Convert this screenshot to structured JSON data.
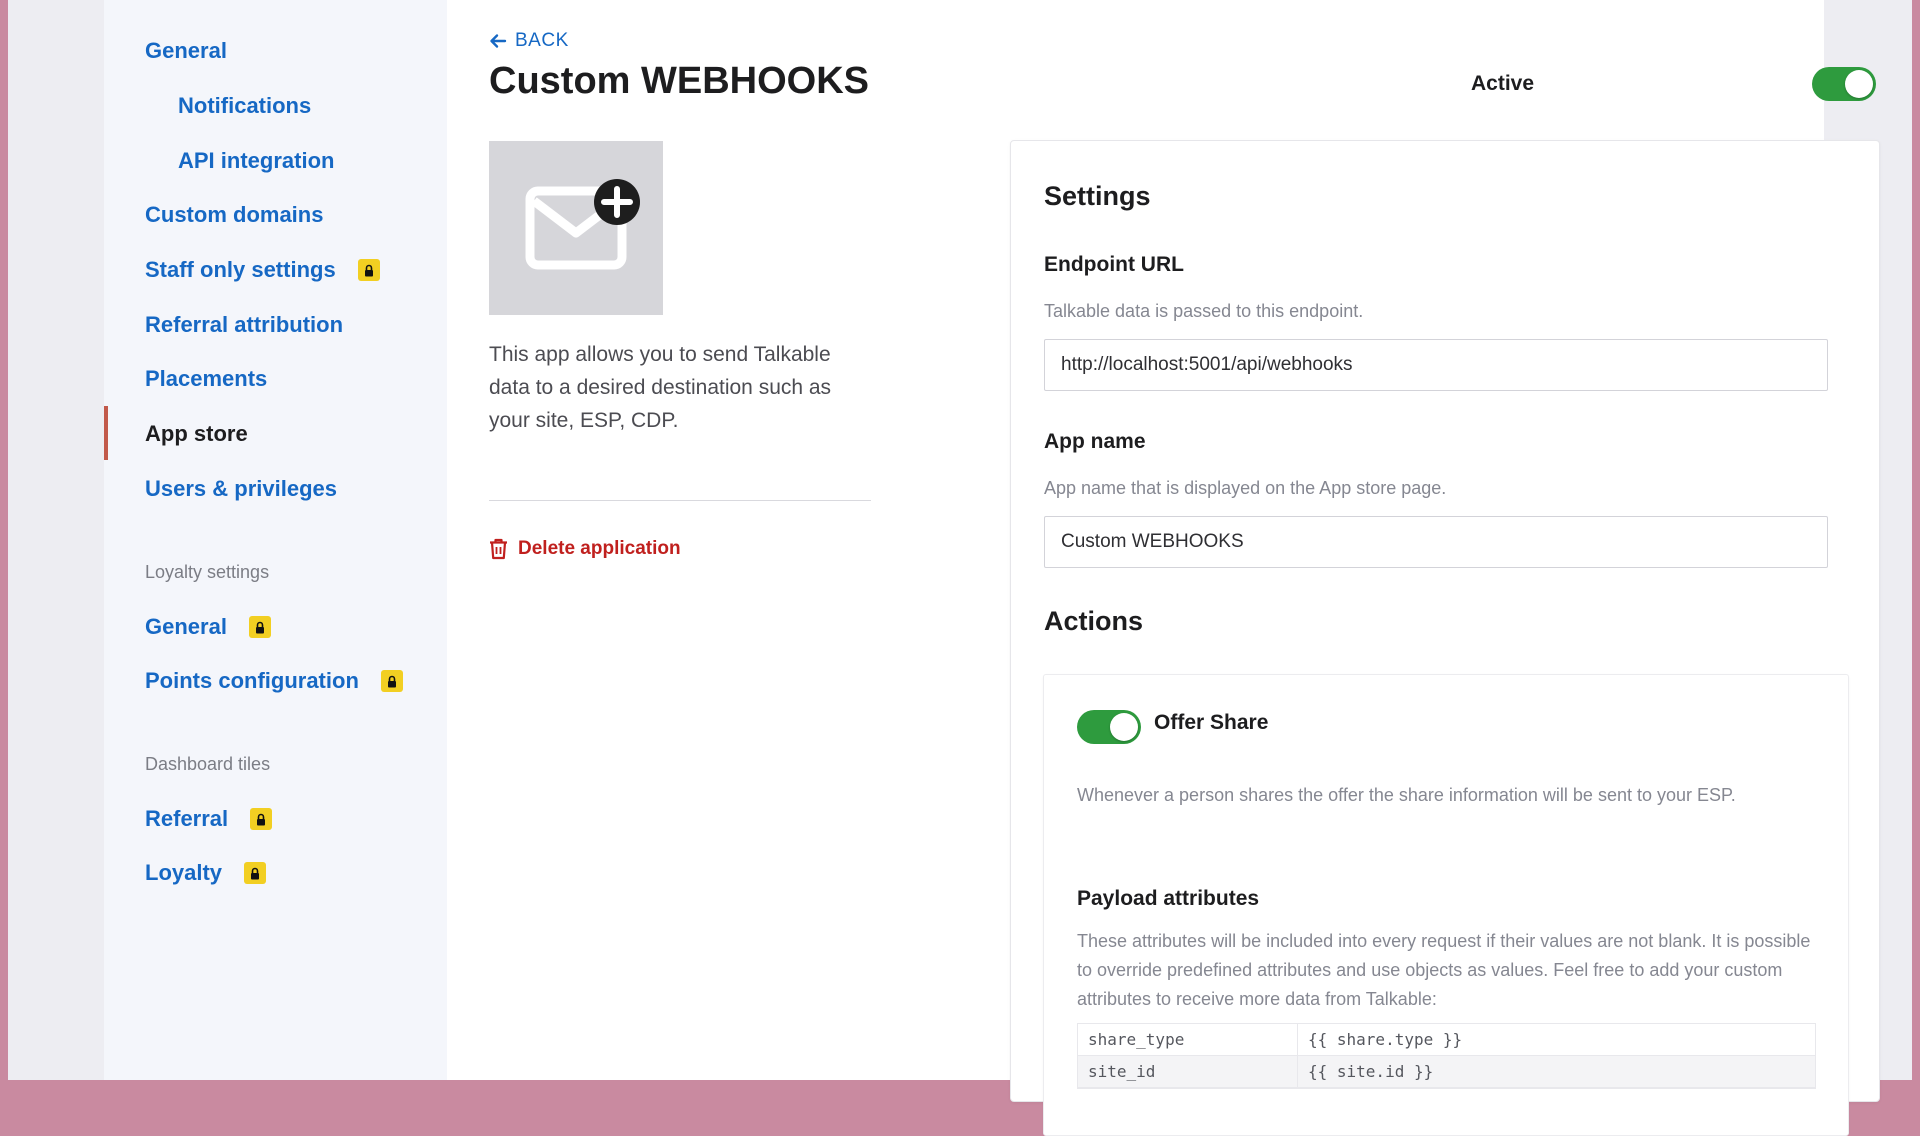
{
  "sidebar": {
    "items": [
      {
        "label": "General",
        "locked": false
      },
      {
        "label": "Notifications",
        "locked": false
      },
      {
        "label": "API integration",
        "locked": false
      },
      {
        "label": "Custom domains",
        "locked": false
      },
      {
        "label": "Staff only settings",
        "locked": true
      },
      {
        "label": "Referral attribution",
        "locked": false
      },
      {
        "label": "Placements",
        "locked": false
      },
      {
        "label": "App store",
        "locked": false,
        "active": true
      },
      {
        "label": "Users & privileges",
        "locked": false
      }
    ],
    "loyalty_section": {
      "title": "Loyalty settings",
      "items": [
        {
          "label": "General",
          "locked": true
        },
        {
          "label": "Points configuration",
          "locked": true
        }
      ]
    },
    "dashboard_section": {
      "title": "Dashboard tiles",
      "items": [
        {
          "label": "Referral",
          "locked": true
        },
        {
          "label": "Loyalty",
          "locked": true
        }
      ]
    }
  },
  "header": {
    "back_label": "BACK",
    "title": "Custom WEBHOOKS",
    "active_label": "Active",
    "active_on": true
  },
  "app_info": {
    "icon": "envelope-plus-icon",
    "description": "This app allows you to send Talkable data to a desired destination such as your site, ESP, CDP.",
    "delete_label": "Delete application"
  },
  "settings": {
    "title": "Settings",
    "endpoint": {
      "label": "Endpoint URL",
      "hint": "Talkable data is passed to this endpoint.",
      "value": "http://localhost:5001/api/webhooks"
    },
    "app_name": {
      "label": "App name",
      "hint": "App name that is displayed on the App store page.",
      "value": "Custom WEBHOOKS"
    },
    "actions_title": "Actions",
    "action": {
      "title": "Offer Share",
      "enabled": true,
      "description": "Whenever a person shares the offer the share information will be sent to your ESP.",
      "payload_title": "Payload attributes",
      "payload_description": "These attributes will be included into every request if their values are not blank. It is possible to override predefined attributes and use objects as values. Feel free to add your custom attributes to receive more data from Talkable:",
      "attributes": [
        {
          "key": "share_type",
          "value": "{{ share.type }}"
        },
        {
          "key": "site_id",
          "value": "{{ site.id }}"
        }
      ]
    }
  },
  "colors": {
    "link": "#1668c4",
    "toggle_on": "#2e9b3e",
    "danger": "#c0201e",
    "lock_badge": "#f2cf22",
    "active_bar": "#c2594a"
  }
}
